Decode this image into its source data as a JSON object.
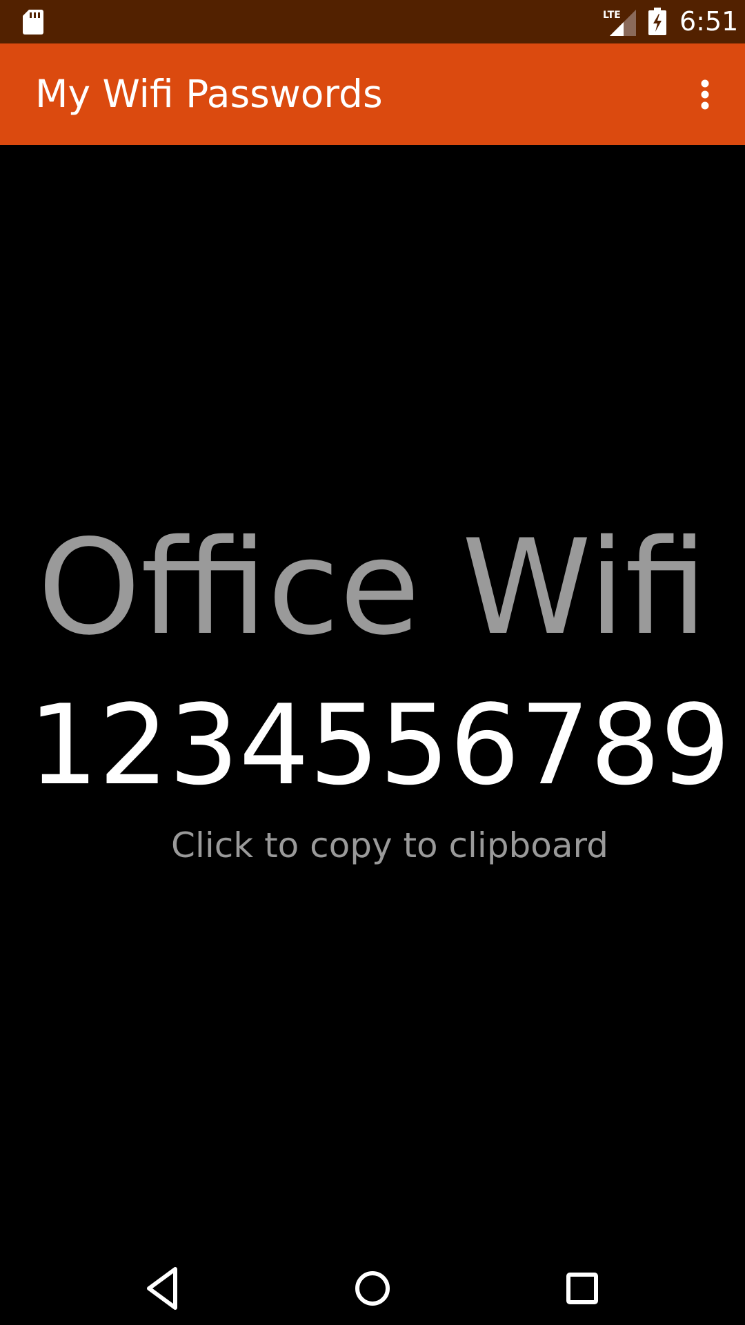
{
  "status_bar": {
    "time": "6:51",
    "network_label": "LTE",
    "icons": [
      "sd-card-icon",
      "lte-signal-icon",
      "battery-charging-icon"
    ]
  },
  "app_bar": {
    "title": "My Wifi Passwords",
    "menu_icon": "overflow-menu-icon",
    "background_color": "#db4a0f"
  },
  "main": {
    "network_name": "Office Wifi",
    "password": "1234556789",
    "hint": "Click to copy to clipboard"
  },
  "nav_bar": {
    "icons": [
      "back-icon",
      "home-icon",
      "recents-icon"
    ]
  },
  "colors": {
    "status_bar": "#522100",
    "accent": "#db4a0f",
    "background": "#000000",
    "network_name_text": "#9a9a9a",
    "password_text": "#ffffff"
  }
}
